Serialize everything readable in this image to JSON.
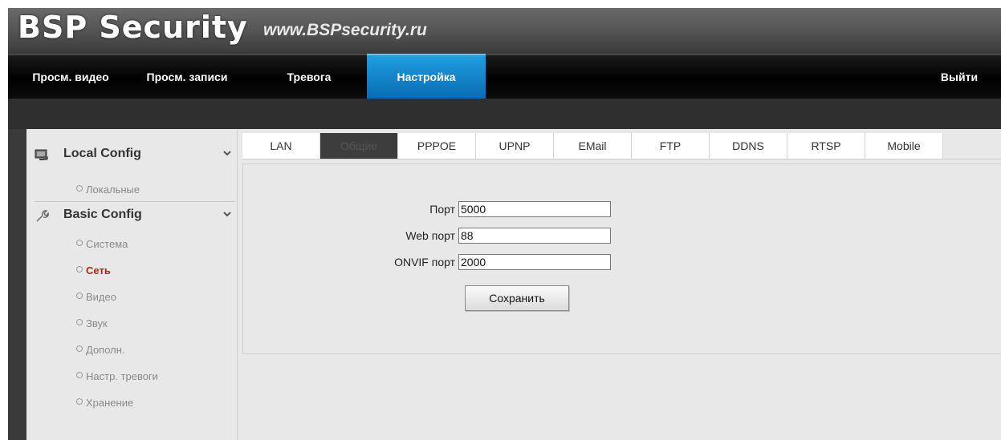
{
  "header": {
    "brand": "BSP Security",
    "url": "www.BSPsecurity.ru"
  },
  "nav": {
    "items": [
      "Просм. видео",
      "Просм. записи",
      "Тревога",
      "Настройка"
    ],
    "active": "Настройка",
    "logout": "Выйти"
  },
  "sidebar": {
    "local_config": {
      "label": "Local Config",
      "items": [
        "Локальные"
      ]
    },
    "basic_config": {
      "label": "Basic Config",
      "items": [
        "Система",
        "Сеть",
        "Видео",
        "Звук",
        "Дополн.",
        "Настр. тревоги",
        "Хранение"
      ],
      "active": "Сеть"
    }
  },
  "tabs": {
    "items": [
      "LAN",
      "Общие",
      "PPPOE",
      "UPNP",
      "EMail",
      "FTP",
      "DDNS",
      "RTSP",
      "Mobile"
    ],
    "active": "Общие"
  },
  "form": {
    "port_label": "Порт",
    "port_value": "5000",
    "web_port_label": "Web порт",
    "web_port_value": "88",
    "onvif_port_label": "ONVIF порт",
    "onvif_port_value": "2000",
    "save_label": "Сохранить"
  },
  "colors": {
    "accent": "#1a8ad4",
    "active_link": "#a52a1a",
    "nav_bg": "#000000"
  }
}
